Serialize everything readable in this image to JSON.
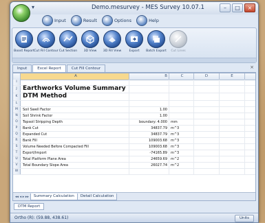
{
  "window": {
    "title": "Demo.mesurvey - MES Survey 10.07.1"
  },
  "ribbon_tabs": [
    {
      "label": "Input"
    },
    {
      "label": "Result"
    },
    {
      "label": "Options"
    },
    {
      "label": "Help"
    }
  ],
  "ribbon_buttons": [
    {
      "label": "Boost Report",
      "icon": "report-icon",
      "enabled": true
    },
    {
      "label": "Cut Fill Contour",
      "icon": "contour-icon",
      "enabled": true
    },
    {
      "label": "Cut Section",
      "icon": "section-icon",
      "enabled": true
    },
    {
      "label": "3D View",
      "icon": "view3d-icon",
      "enabled": true
    },
    {
      "label": "3D Fill View",
      "icon": "fillview-icon",
      "enabled": true
    },
    {
      "label": "Export",
      "icon": "export-icon",
      "enabled": true
    },
    {
      "label": "Batch Export",
      "icon": "batch-export-icon",
      "enabled": true
    },
    {
      "label": "Cut Lines",
      "icon": "cut-lines-icon",
      "enabled": false
    }
  ],
  "doc_tabs": [
    "Input",
    "Excel Report",
    "Cut Fill Contour"
  ],
  "sheet": {
    "columns": [
      "A",
      "B",
      "C",
      "D",
      "E"
    ],
    "rows": [
      {
        "h": "I",
        "a": "",
        "b": "",
        "c": ""
      },
      {
        "h": "J",
        "a": "Earthworks Volume Summary",
        "b": "",
        "c": "",
        "cls": "title1 big"
      },
      {
        "h": "K",
        "a": "DTM Method",
        "b": "",
        "c": "",
        "cls": "title2 big"
      },
      {
        "h": "L",
        "a": "",
        "b": "",
        "c": ""
      },
      {
        "h": "M",
        "a": "Soil Swell Factor",
        "b": "1.00",
        "c": ""
      },
      {
        "h": "N",
        "a": "Soil Shrink Factor",
        "b": "1.00",
        "c": ""
      },
      {
        "h": "O",
        "a": "Topsoil Stripping Depth",
        "b": "boundary: 4.000",
        "c": "mm"
      },
      {
        "h": "P",
        "a": "Bank Cut",
        "b": "34837.79",
        "c": "m^3"
      },
      {
        "h": "Q",
        "a": "Expanded Cut",
        "b": "34837.79",
        "c": "m^3"
      },
      {
        "h": "R",
        "a": "Bank Fill",
        "b": "109003.68",
        "c": "m^3"
      },
      {
        "h": "S",
        "a": "Volume Needed Before Compacted Fill",
        "b": "109003.68",
        "c": "m^3"
      },
      {
        "h": "T",
        "a": "Export/Import",
        "b": "-74165.89",
        "c": "m^3"
      },
      {
        "h": "U",
        "a": "Total Platform Plane Area",
        "b": "24659.69",
        "c": "m^2"
      },
      {
        "h": "V",
        "a": "Total Boundary Slope Area",
        "b": "26027.74",
        "c": "m^2"
      },
      {
        "h": "W",
        "a": "",
        "b": "",
        "c": ""
      }
    ]
  },
  "sheet_tabs": [
    "Summary Calculation",
    "Detail Calculation"
  ],
  "bottom_panel_tab": "DTM Report",
  "status": {
    "text": "Ortho (R): (59.88, 438.61)",
    "units": "Units"
  }
}
